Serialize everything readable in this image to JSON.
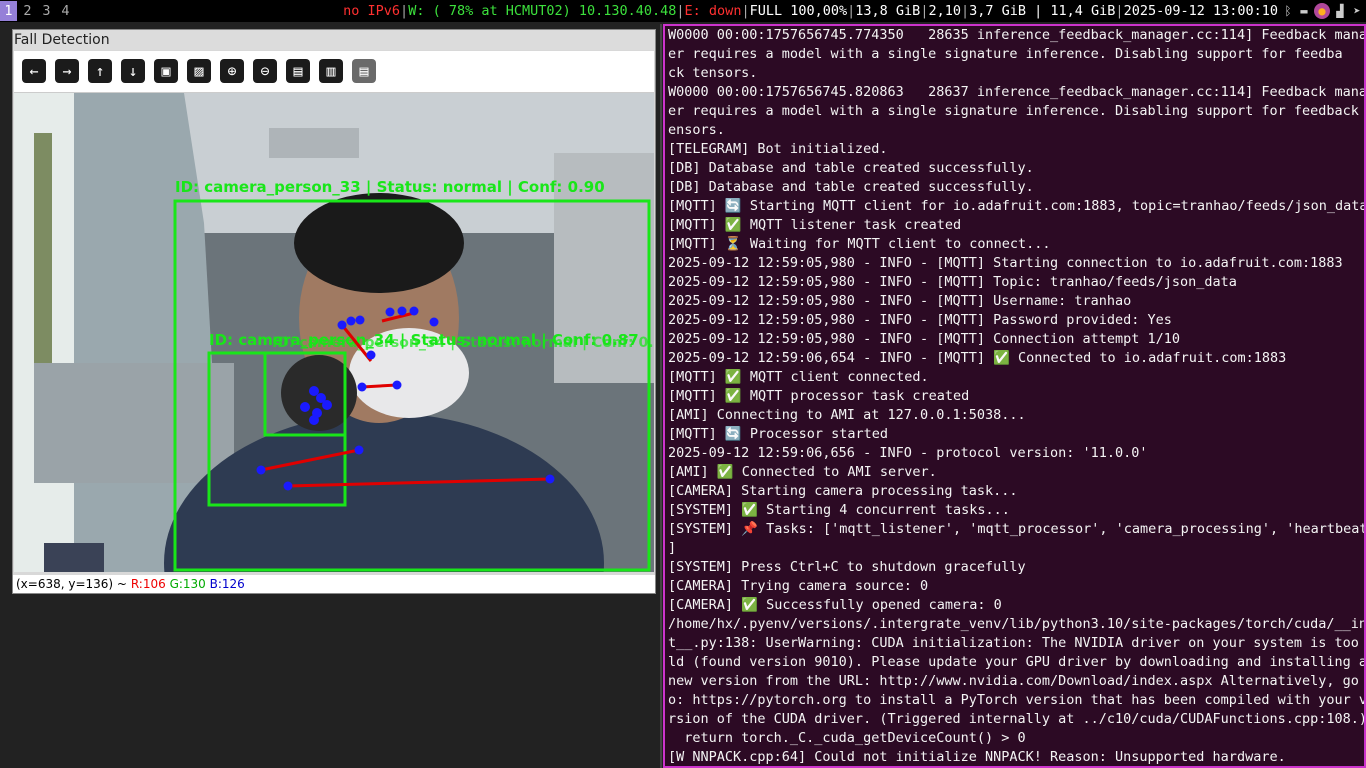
{
  "statusbar": {
    "workspaces": [
      "1",
      "2",
      "3",
      "4"
    ],
    "active_workspace": "1",
    "ipv6": "no IPv6",
    "wifi": "W: ( 78% at HCMUT02) 10.130.40.48",
    "ethernet": "E: down",
    "battery": "FULL 100,00%",
    "disk": "13,8 GiB",
    "load": "2,10",
    "memory": "3,7 GiB | 11,4 GiB",
    "datetime": "2025-09-12 13:00:10",
    "tray_icons": [
      "bluetooth-icon",
      "drive-icon",
      "firefox-icon",
      "signal-icon",
      "telegram-icon"
    ]
  },
  "viewer": {
    "title": "Fall Detection",
    "toolbar_icons": [
      "arrow-left-icon",
      "arrow-right-icon",
      "arrow-up-icon",
      "arrow-down-icon",
      "image-icon",
      "image-settings-icon",
      "zoom-in-icon",
      "zoom-out-icon",
      "save-icon",
      "clipboard-icon",
      "save-disabled-icon"
    ],
    "toolbar_glyphs": [
      "←",
      "→",
      "↑",
      "↓",
      "▣",
      "▨",
      "⊕",
      "⊖",
      "▤",
      "▥",
      "▤"
    ],
    "detections": [
      {
        "label": "ID: camera_person_33 | Status: normal | Conf: 0.90"
      },
      {
        "label": "ID: camera_person_34 | Status: normal | Conf: 0.87"
      }
    ],
    "overlay_noise_text": "ID: camera_person_34 | Status: normal | Conf: 0.54",
    "readout": {
      "coords": "(x=638, y=136) ~",
      "r": "R:106",
      "g": "G:130",
      "b": "B:126"
    }
  },
  "terminal": {
    "lines": [
      "W0000 00:00:1757656745.774350   28635 inference_feedback_manager.cc:114] Feedback manag",
      "er requires a model with a single signature inference. Disabling support for feedba",
      "ck tensors.",
      "W0000 00:00:1757656745.820863   28637 inference_feedback_manager.cc:114] Feedback manag",
      "er requires a model with a single signature inference. Disabling support for feedback t",
      "ensors.",
      "[TELEGRAM] Bot initialized.",
      "[DB] Database and table created successfully.",
      "[DB] Database and table created successfully.",
      "[MQTT] 🔄 Starting MQTT client for io.adafruit.com:1883, topic=tranhao/feeds/json_data",
      "[MQTT] ✅ MQTT listener task created",
      "[MQTT] ⏳ Waiting for MQTT client to connect...",
      "2025-09-12 12:59:05,980 - INFO - [MQTT] Starting connection to io.adafruit.com:1883",
      "2025-09-12 12:59:05,980 - INFO - [MQTT] Topic: tranhao/feeds/json_data",
      "2025-09-12 12:59:05,980 - INFO - [MQTT] Username: tranhao",
      "2025-09-12 12:59:05,980 - INFO - [MQTT] Password provided: Yes",
      "2025-09-12 12:59:05,980 - INFO - [MQTT] Connection attempt 1/10",
      "2025-09-12 12:59:06,654 - INFO - [MQTT] ✅ Connected to io.adafruit.com:1883",
      "[MQTT] ✅ MQTT client connected.",
      "[MQTT] ✅ MQTT processor task created",
      "[AMI] Connecting to AMI at 127.0.0.1:5038...",
      "[MQTT] 🔄 Processor started",
      "2025-09-12 12:59:06,656 - INFO - protocol version: '11.0.0'",
      "[AMI] ✅ Connected to AMI server.",
      "[CAMERA] Starting camera processing task...",
      "[SYSTEM] ✅ Starting 4 concurrent tasks...",
      "[SYSTEM] 📌 Tasks: ['mqtt_listener', 'mqtt_processor', 'camera_processing', 'heartbeat'",
      "]",
      "[SYSTEM] Press Ctrl+C to shutdown gracefully",
      "[CAMERA] Trying camera source: 0",
      "[CAMERA] ✅ Successfully opened camera: 0",
      "/home/hx/.pyenv/versions/.intergrate_venv/lib/python3.10/site-packages/torch/cuda/__ini",
      "t__.py:138: UserWarning: CUDA initialization: The NVIDIA driver on your system is too o",
      "ld (found version 9010). Please update your GPU driver by downloading and installing a",
      "new version from the URL: http://www.nvidia.com/Download/index.aspx Alternatively, go t",
      "o: https://pytorch.org to install a PyTorch version that has been compiled with your ve",
      "rsion of the CUDA driver. (Triggered internally at ../c10/cuda/CUDAFunctions.cpp:108.)",
      "  return torch._C._cuda_getDeviceCount() > 0",
      "[W NNPACK.cpp:64] Could not initialize NNPACK! Reason: Unsupported hardware."
    ]
  }
}
